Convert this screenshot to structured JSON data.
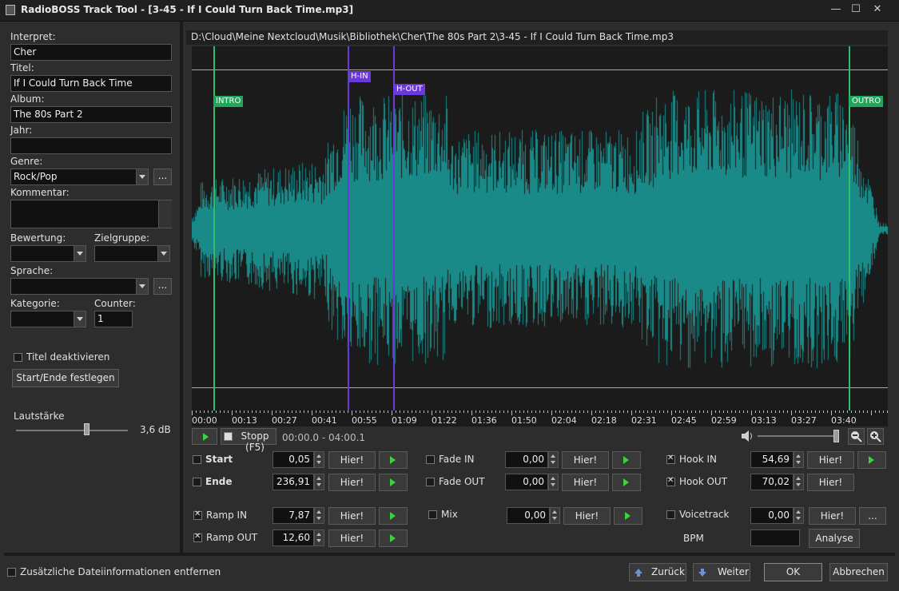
{
  "window": {
    "title": "RadioBOSS Track Tool - [3-45 - If I Could Turn Back Time.mp3]",
    "minimize": "—",
    "maximize": "☐",
    "close": "✕"
  },
  "tags": {
    "interpret_label": "Interpret:",
    "interpret": "Cher",
    "titel_label": "Titel:",
    "titel": "If I Could Turn Back Time",
    "album_label": "Album:",
    "album": "The 80s Part 2",
    "jahr_label": "Jahr:",
    "jahr": "",
    "genre_label": "Genre:",
    "genre": "Rock/Pop",
    "kommentar_label": "Kommentar:",
    "kommentar": "",
    "bewertung_label": "Bewertung:",
    "bewertung": "",
    "zielgruppe_label": "Zielgruppe:",
    "zielgruppe": "",
    "sprache_label": "Sprache:",
    "sprache": "",
    "kategorie_label": "Kategorie:",
    "kategorie": "",
    "counter_label": "Counter:",
    "counter": "1",
    "ellipsis": "...",
    "titel_deaktivieren": "Titel deaktivieren",
    "start_ende_button": "Start/Ende festlegen",
    "lautstaerke_label": "Lautstärke",
    "lautstaerke_value": "3,6 dB",
    "lautstaerke_level": 0.63
  },
  "file_path": "D:\\Cloud\\Meine Nextcloud\\Musik\\Bibliothek\\Cher\\The 80s Part 2\\3-45 - If I Could Turn Back Time.mp3",
  "waveform": {
    "markers": {
      "intro": "INTRO",
      "outro": "OUTRO",
      "hin": "H-IN",
      "hout": "H-OUT"
    },
    "timeline": [
      "00:00",
      "00:13",
      "00:27",
      "00:41",
      "00:55",
      "01:09",
      "01:22",
      "01:36",
      "01:50",
      "02:04",
      "02:18",
      "02:31",
      "02:45",
      "02:59",
      "03:13",
      "03:27",
      "03:40"
    ],
    "colors": {
      "wave": "#1a8a88",
      "marker_green": "#2fbf6a",
      "marker_purple": "#6a3ad8",
      "bg": "#1b1b1b"
    }
  },
  "transport": {
    "stopp_label": "Stopp (F5)",
    "time_range": "00:00.0 - 04:00.1",
    "volume_level": 0.98
  },
  "controls": {
    "hier": "Hier!",
    "start_label": "Start",
    "start_value": "0,05",
    "start_checked": false,
    "ende_label": "Ende",
    "ende_value": "236,91",
    "ende_checked": false,
    "fade_in_label": "Fade IN",
    "fade_in_value": "0,00",
    "fade_out_label": "Fade OUT",
    "fade_out_value": "0,00",
    "hook_in_label": "Hook IN",
    "hook_in_value": "54,69",
    "hook_out_label": "Hook OUT",
    "hook_out_value": "70,02",
    "ramp_in_label": "Ramp IN",
    "ramp_in_value": "7,87",
    "ramp_out_label": "Ramp OUT",
    "ramp_out_value": "12,60",
    "mix_label": "Mix",
    "mix_value": "0,00",
    "voicetrack_label": "Voicetrack",
    "voicetrack_value": "0,00",
    "bpm_label": "BPM",
    "bpm_value": "",
    "analyse_button": "Analyse",
    "ellipsis": "..."
  },
  "footer": {
    "remove_info_label": "Zusätzliche Dateiinformationen entfernen",
    "zurueck": "Zurück",
    "weiter": "Weiter",
    "ok": "OK",
    "abbrechen": "Abbrechen"
  }
}
